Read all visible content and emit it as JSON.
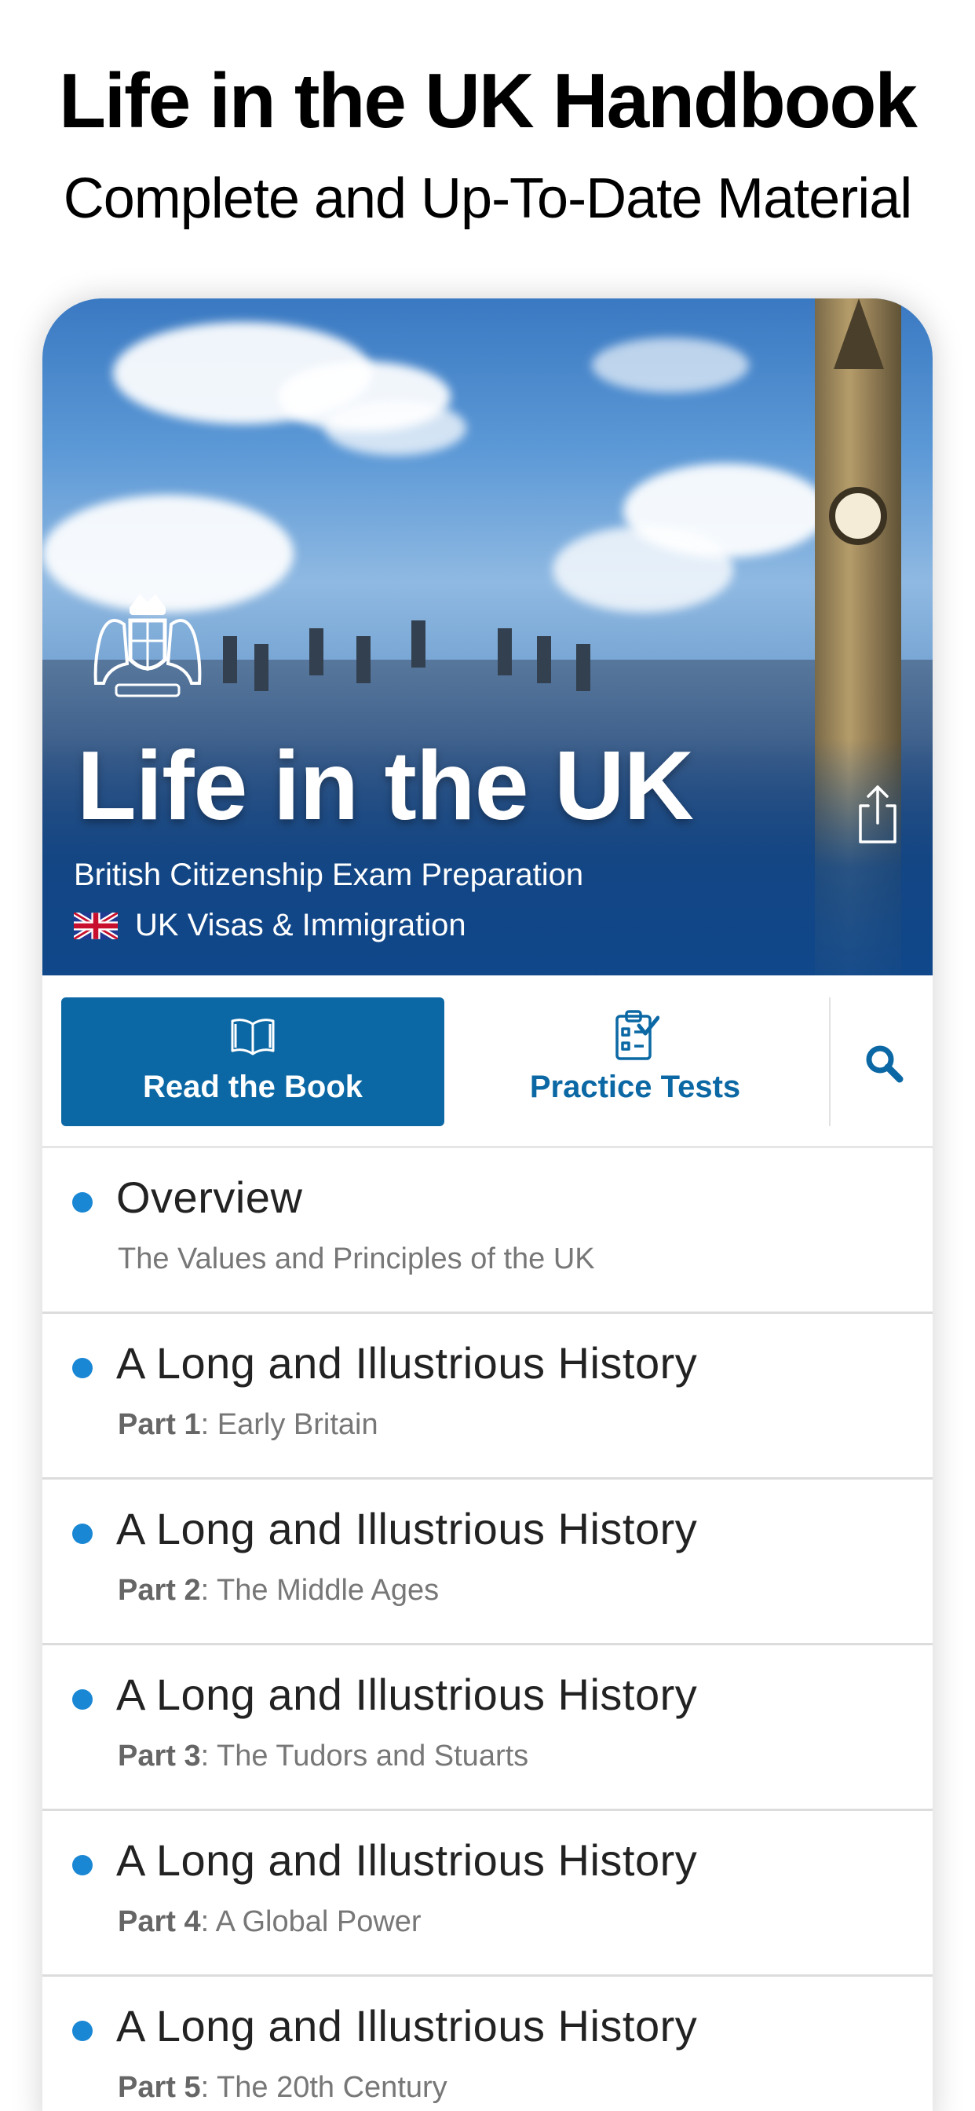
{
  "promo": {
    "title": "Life in the UK Handbook",
    "subtitle": "Complete and Up-To-Date Material"
  },
  "hero": {
    "title": "Life in the UK",
    "subtitle": "British Citizenship Exam Preparation",
    "visa_label": "UK Visas & Immigration",
    "share_icon": "share-icon",
    "crest_icon": "royal-crest-icon"
  },
  "toolbar": {
    "read_label": "Read the Book",
    "tests_label": "Practice Tests",
    "read_icon": "open-book-icon",
    "tests_icon": "clipboard-check-icon",
    "search_icon": "search-icon"
  },
  "colors": {
    "accent": "#0b68a4",
    "bullet": "#1a87d4"
  },
  "list": [
    {
      "title": "Overview",
      "part": "",
      "subtitle": "The Values and Principles of the UK"
    },
    {
      "title": "A Long and Illustrious History",
      "part": "Part 1",
      "subtitle": ": Early Britain"
    },
    {
      "title": "A Long and Illustrious History",
      "part": "Part 2",
      "subtitle": ": The Middle Ages"
    },
    {
      "title": "A Long and Illustrious History",
      "part": "Part 3",
      "subtitle": ": The Tudors and Stuarts"
    },
    {
      "title": "A Long and Illustrious History",
      "part": "Part 4",
      "subtitle": ": A Global Power"
    },
    {
      "title": "A Long and Illustrious History",
      "part": "Part 5",
      "subtitle": ": The 20th Century"
    }
  ]
}
